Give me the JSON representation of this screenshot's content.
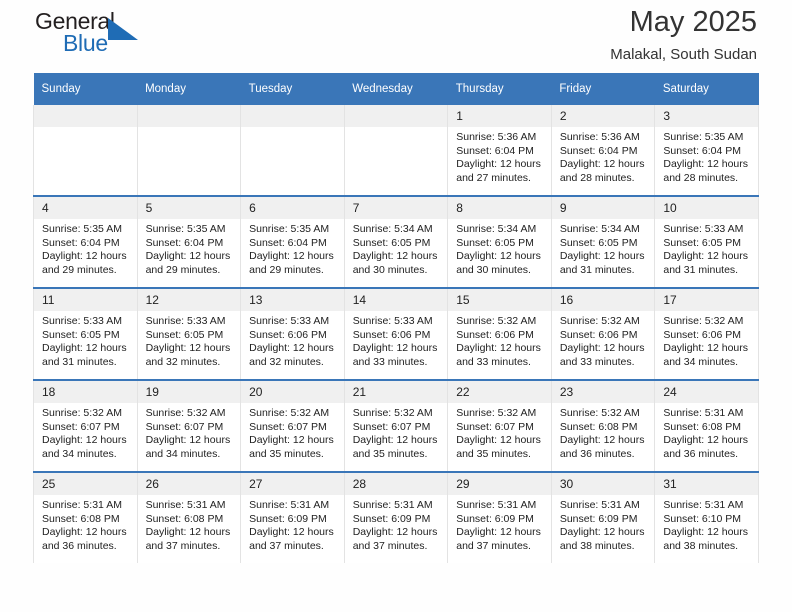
{
  "brand": {
    "word_general": "General",
    "word_blue": "Blue",
    "flag_icon": "blue-triangle-flag-icon"
  },
  "header": {
    "title": "May 2025",
    "subtitle": "Malakal, South Sudan"
  },
  "colors": {
    "header_blue": "#3a76b8",
    "daynum_band": "#f0f0f0",
    "brand_blue": "#1f6cb5",
    "text": "#222222"
  },
  "calendar": {
    "weekday_headers": [
      "Sunday",
      "Monday",
      "Tuesday",
      "Wednesday",
      "Thursday",
      "Friday",
      "Saturday"
    ],
    "weeks": [
      [
        {
          "day": "",
          "lines": []
        },
        {
          "day": "",
          "lines": []
        },
        {
          "day": "",
          "lines": []
        },
        {
          "day": "",
          "lines": []
        },
        {
          "day": "1",
          "lines": [
            "Sunrise: 5:36 AM",
            "Sunset: 6:04 PM",
            "Daylight: 12 hours",
            "and 27 minutes."
          ]
        },
        {
          "day": "2",
          "lines": [
            "Sunrise: 5:36 AM",
            "Sunset: 6:04 PM",
            "Daylight: 12 hours",
            "and 28 minutes."
          ]
        },
        {
          "day": "3",
          "lines": [
            "Sunrise: 5:35 AM",
            "Sunset: 6:04 PM",
            "Daylight: 12 hours",
            "and 28 minutes."
          ]
        }
      ],
      [
        {
          "day": "4",
          "lines": [
            "Sunrise: 5:35 AM",
            "Sunset: 6:04 PM",
            "Daylight: 12 hours",
            "and 29 minutes."
          ]
        },
        {
          "day": "5",
          "lines": [
            "Sunrise: 5:35 AM",
            "Sunset: 6:04 PM",
            "Daylight: 12 hours",
            "and 29 minutes."
          ]
        },
        {
          "day": "6",
          "lines": [
            "Sunrise: 5:35 AM",
            "Sunset: 6:04 PM",
            "Daylight: 12 hours",
            "and 29 minutes."
          ]
        },
        {
          "day": "7",
          "lines": [
            "Sunrise: 5:34 AM",
            "Sunset: 6:05 PM",
            "Daylight: 12 hours",
            "and 30 minutes."
          ]
        },
        {
          "day": "8",
          "lines": [
            "Sunrise: 5:34 AM",
            "Sunset: 6:05 PM",
            "Daylight: 12 hours",
            "and 30 minutes."
          ]
        },
        {
          "day": "9",
          "lines": [
            "Sunrise: 5:34 AM",
            "Sunset: 6:05 PM",
            "Daylight: 12 hours",
            "and 31 minutes."
          ]
        },
        {
          "day": "10",
          "lines": [
            "Sunrise: 5:33 AM",
            "Sunset: 6:05 PM",
            "Daylight: 12 hours",
            "and 31 minutes."
          ]
        }
      ],
      [
        {
          "day": "11",
          "lines": [
            "Sunrise: 5:33 AM",
            "Sunset: 6:05 PM",
            "Daylight: 12 hours",
            "and 31 minutes."
          ]
        },
        {
          "day": "12",
          "lines": [
            "Sunrise: 5:33 AM",
            "Sunset: 6:05 PM",
            "Daylight: 12 hours",
            "and 32 minutes."
          ]
        },
        {
          "day": "13",
          "lines": [
            "Sunrise: 5:33 AM",
            "Sunset: 6:06 PM",
            "Daylight: 12 hours",
            "and 32 minutes."
          ]
        },
        {
          "day": "14",
          "lines": [
            "Sunrise: 5:33 AM",
            "Sunset: 6:06 PM",
            "Daylight: 12 hours",
            "and 33 minutes."
          ]
        },
        {
          "day": "15",
          "lines": [
            "Sunrise: 5:32 AM",
            "Sunset: 6:06 PM",
            "Daylight: 12 hours",
            "and 33 minutes."
          ]
        },
        {
          "day": "16",
          "lines": [
            "Sunrise: 5:32 AM",
            "Sunset: 6:06 PM",
            "Daylight: 12 hours",
            "and 33 minutes."
          ]
        },
        {
          "day": "17",
          "lines": [
            "Sunrise: 5:32 AM",
            "Sunset: 6:06 PM",
            "Daylight: 12 hours",
            "and 34 minutes."
          ]
        }
      ],
      [
        {
          "day": "18",
          "lines": [
            "Sunrise: 5:32 AM",
            "Sunset: 6:07 PM",
            "Daylight: 12 hours",
            "and 34 minutes."
          ]
        },
        {
          "day": "19",
          "lines": [
            "Sunrise: 5:32 AM",
            "Sunset: 6:07 PM",
            "Daylight: 12 hours",
            "and 34 minutes."
          ]
        },
        {
          "day": "20",
          "lines": [
            "Sunrise: 5:32 AM",
            "Sunset: 6:07 PM",
            "Daylight: 12 hours",
            "and 35 minutes."
          ]
        },
        {
          "day": "21",
          "lines": [
            "Sunrise: 5:32 AM",
            "Sunset: 6:07 PM",
            "Daylight: 12 hours",
            "and 35 minutes."
          ]
        },
        {
          "day": "22",
          "lines": [
            "Sunrise: 5:32 AM",
            "Sunset: 6:07 PM",
            "Daylight: 12 hours",
            "and 35 minutes."
          ]
        },
        {
          "day": "23",
          "lines": [
            "Sunrise: 5:32 AM",
            "Sunset: 6:08 PM",
            "Daylight: 12 hours",
            "and 36 minutes."
          ]
        },
        {
          "day": "24",
          "lines": [
            "Sunrise: 5:31 AM",
            "Sunset: 6:08 PM",
            "Daylight: 12 hours",
            "and 36 minutes."
          ]
        }
      ],
      [
        {
          "day": "25",
          "lines": [
            "Sunrise: 5:31 AM",
            "Sunset: 6:08 PM",
            "Daylight: 12 hours",
            "and 36 minutes."
          ]
        },
        {
          "day": "26",
          "lines": [
            "Sunrise: 5:31 AM",
            "Sunset: 6:08 PM",
            "Daylight: 12 hours",
            "and 37 minutes."
          ]
        },
        {
          "day": "27",
          "lines": [
            "Sunrise: 5:31 AM",
            "Sunset: 6:09 PM",
            "Daylight: 12 hours",
            "and 37 minutes."
          ]
        },
        {
          "day": "28",
          "lines": [
            "Sunrise: 5:31 AM",
            "Sunset: 6:09 PM",
            "Daylight: 12 hours",
            "and 37 minutes."
          ]
        },
        {
          "day": "29",
          "lines": [
            "Sunrise: 5:31 AM",
            "Sunset: 6:09 PM",
            "Daylight: 12 hours",
            "and 37 minutes."
          ]
        },
        {
          "day": "30",
          "lines": [
            "Sunrise: 5:31 AM",
            "Sunset: 6:09 PM",
            "Daylight: 12 hours",
            "and 38 minutes."
          ]
        },
        {
          "day": "31",
          "lines": [
            "Sunrise: 5:31 AM",
            "Sunset: 6:10 PM",
            "Daylight: 12 hours",
            "and 38 minutes."
          ]
        }
      ]
    ]
  }
}
